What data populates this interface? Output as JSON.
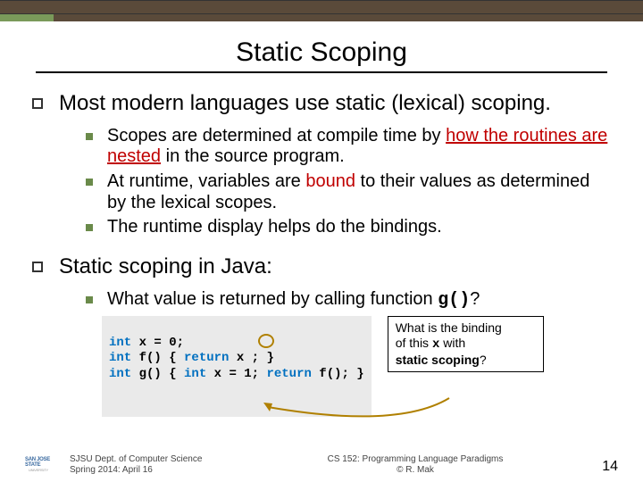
{
  "title": "Static Scoping",
  "bullets": {
    "b1": "Most modern languages use static (lexical) scoping.",
    "b1_sub1_a": "Scopes are determined at compile time by ",
    "b1_sub1_b": "how the routines are nested",
    "b1_sub1_c": " in the source program.",
    "b1_sub2_a": "At runtime, variables are ",
    "b1_sub2_b": "bound",
    "b1_sub2_c": " to their values as determined by the lexical scopes.",
    "b1_sub3": "The runtime display helps do the bindings.",
    "b2": "Static scoping in Java:",
    "b2_sub1_a": "What value is returned by calling function ",
    "b2_sub1_b": "g()",
    "b2_sub1_c": "?"
  },
  "code": {
    "line1_a": "int",
    "line1_b": " x = 0;",
    "line2_a": "int",
    "line2_b": " f() { ",
    "line2_c": "return",
    "line2_d": " x ; }",
    "line3_a": "int",
    "line3_b": " g() { ",
    "line3_c": "int",
    "line3_d": " x = 1; ",
    "line3_e": "return",
    "line3_f": " f(); }"
  },
  "callout": {
    "l1": "What is the binding",
    "l2a": "of this ",
    "l2b": "x",
    "l2c": " with",
    "l3": "static scoping",
    "l3b": "?"
  },
  "footer": {
    "left1": "SJSU Dept. of Computer Science",
    "left2": "Spring 2014: April 16",
    "center1": "CS 152: Programming Language Paradigms",
    "center2": "© R. Mak",
    "page": "14"
  },
  "logo": {
    "top": "SAN JOSE STATE",
    "bot": "UNIVERSITY"
  }
}
